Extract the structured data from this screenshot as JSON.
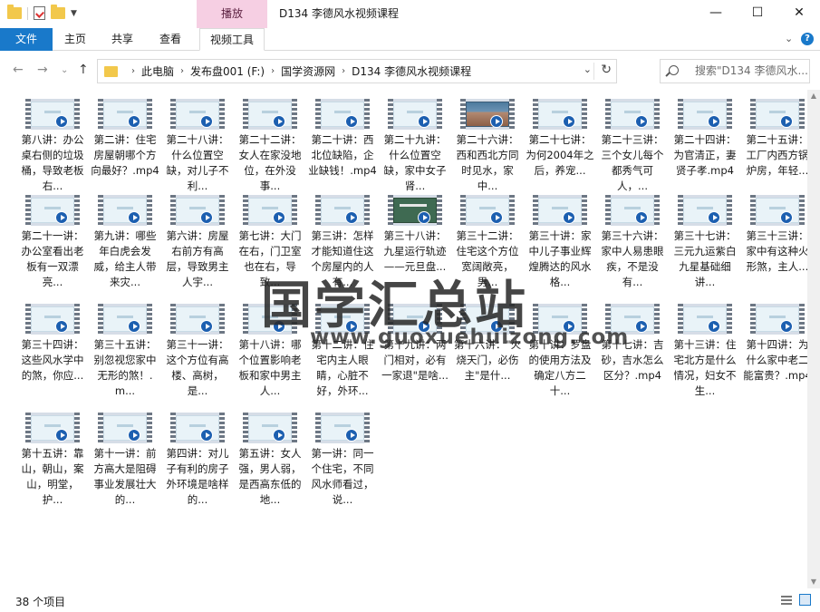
{
  "window": {
    "title": "D134 李德风水视频课程",
    "context_tab": "播放",
    "buttons": {
      "minimize": "—",
      "maximize": "☐",
      "close": "✕"
    }
  },
  "ribbon": {
    "tabs": [
      "文件",
      "主页",
      "共享",
      "查看",
      "视频工具"
    ],
    "expand": "⌄",
    "help": "?"
  },
  "address": {
    "crumbs": [
      "此电脑",
      "发布盘001 (F:)",
      "国学资源网",
      "D134 李德风水视频课程"
    ],
    "search_placeholder": "搜索\"D134 李德风水..."
  },
  "items": [
    {
      "label": "第八讲：办公桌右侧的垃圾桶，导致老板右...",
      "thumb": "plain"
    },
    {
      "label": "第二讲：住宅房屋朝哪个方向最好？.mp4",
      "thumb": "plain"
    },
    {
      "label": "第二十八讲：什么位置空缺，对儿子不利...",
      "thumb": "plain"
    },
    {
      "label": "第二十二讲：女人在家没地位，在外没事...",
      "thumb": "plain"
    },
    {
      "label": "第二十讲：西北位缺陷，企业缺钱！.mp4",
      "thumb": "plain"
    },
    {
      "label": "第二十九讲：什么位置空缺，家中女子肾...",
      "thumb": "plain"
    },
    {
      "label": "第二十六讲：西和西北方同时见水，家中...",
      "thumb": "photo"
    },
    {
      "label": "第二十七讲：为何2004年之后，养宠...",
      "thumb": "plain"
    },
    {
      "label": "第二十三讲：三个女儿每个都秀气可人，...",
      "thumb": "plain"
    },
    {
      "label": "第二十四讲：为官清正，妻贤子孝.mp4",
      "thumb": "plain"
    },
    {
      "label": "第二十五讲：工厂内西方锅炉房，年轻...",
      "thumb": "plain"
    },
    {
      "label": "第二十一讲：办公室看出老板有一双漂亮...",
      "thumb": "plain"
    },
    {
      "label": "第九讲：哪些年白虎会发威，给主人带来灾...",
      "thumb": "plain"
    },
    {
      "label": "第六讲：房屋右前方有高层，导致男主人宇...",
      "thumb": "plain"
    },
    {
      "label": "第七讲：大门在右，门卫室也在右，导致...",
      "thumb": "plain"
    },
    {
      "label": "第三讲：怎样才能知道住这个房屋内的人有...",
      "thumb": "plain"
    },
    {
      "label": "第三十八讲：九星运行轨迹——元旦盘...",
      "thumb": "board"
    },
    {
      "label": "第三十二讲：住宅这个方位宽阔敞亮，男...",
      "thumb": "plain"
    },
    {
      "label": "第三十讲：家中儿子事业辉煌腾达的风水格...",
      "thumb": "plain"
    },
    {
      "label": "第三十六讲：家中人易患眼疾，不是没有...",
      "thumb": "plain"
    },
    {
      "label": "第三十七讲：三元九运紫白九星基础细讲...",
      "thumb": "plain"
    },
    {
      "label": "第三十三讲：家中有这种火形煞，主人...",
      "thumb": "plain"
    },
    {
      "label": "第三十四讲：这些风水学中的煞，你应...",
      "thumb": "plain"
    },
    {
      "label": "第三十五讲：别忽视您家中无形的煞！.m...",
      "thumb": "plain"
    },
    {
      "label": "第三十一讲：这个方位有高楼、高树，是...",
      "thumb": "plain"
    },
    {
      "label": "第十八讲：哪个位置影响老板和家中男主人...",
      "thumb": "plain"
    },
    {
      "label": "第十二讲：住宅内主人眼睛，心脏不好，外环...",
      "thumb": "plain"
    },
    {
      "label": "第十九讲：两门相对，必有一家退\"是啥...",
      "thumb": "plain"
    },
    {
      "label": "第十六讲：\"火烧天门，必伤主\"是什...",
      "thumb": "plain"
    },
    {
      "label": "第十讲：罗盘的使用方法及确定八方二十...",
      "thumb": "plain"
    },
    {
      "label": "第十七讲：吉砂，吉水怎么区分？.mp4",
      "thumb": "plain"
    },
    {
      "label": "第十三讲：住宅北方是什么情况，妇女不生...",
      "thumb": "plain"
    },
    {
      "label": "第十四讲：为什么家中老二能富贵？.mp4",
      "thumb": "plain"
    },
    {
      "label": "第十五讲：靠山，朝山，案山，明堂，护...",
      "thumb": "plain"
    },
    {
      "label": "第十一讲：前方高大是阻碍事业发展壮大的...",
      "thumb": "plain"
    },
    {
      "label": "第四讲：对儿子有利的房子外环境是啥样的...",
      "thumb": "plain"
    },
    {
      "label": "第五讲：女人强，男人弱，是西高东低的地...",
      "thumb": "plain"
    },
    {
      "label": "第一讲：同一个住宅，不同风水师看过，说...",
      "thumb": "plain"
    }
  ],
  "watermark": {
    "text": "国学汇总站",
    "url": "www.guoxuehuizong.com"
  },
  "status": {
    "count_text": "38 个项目"
  }
}
